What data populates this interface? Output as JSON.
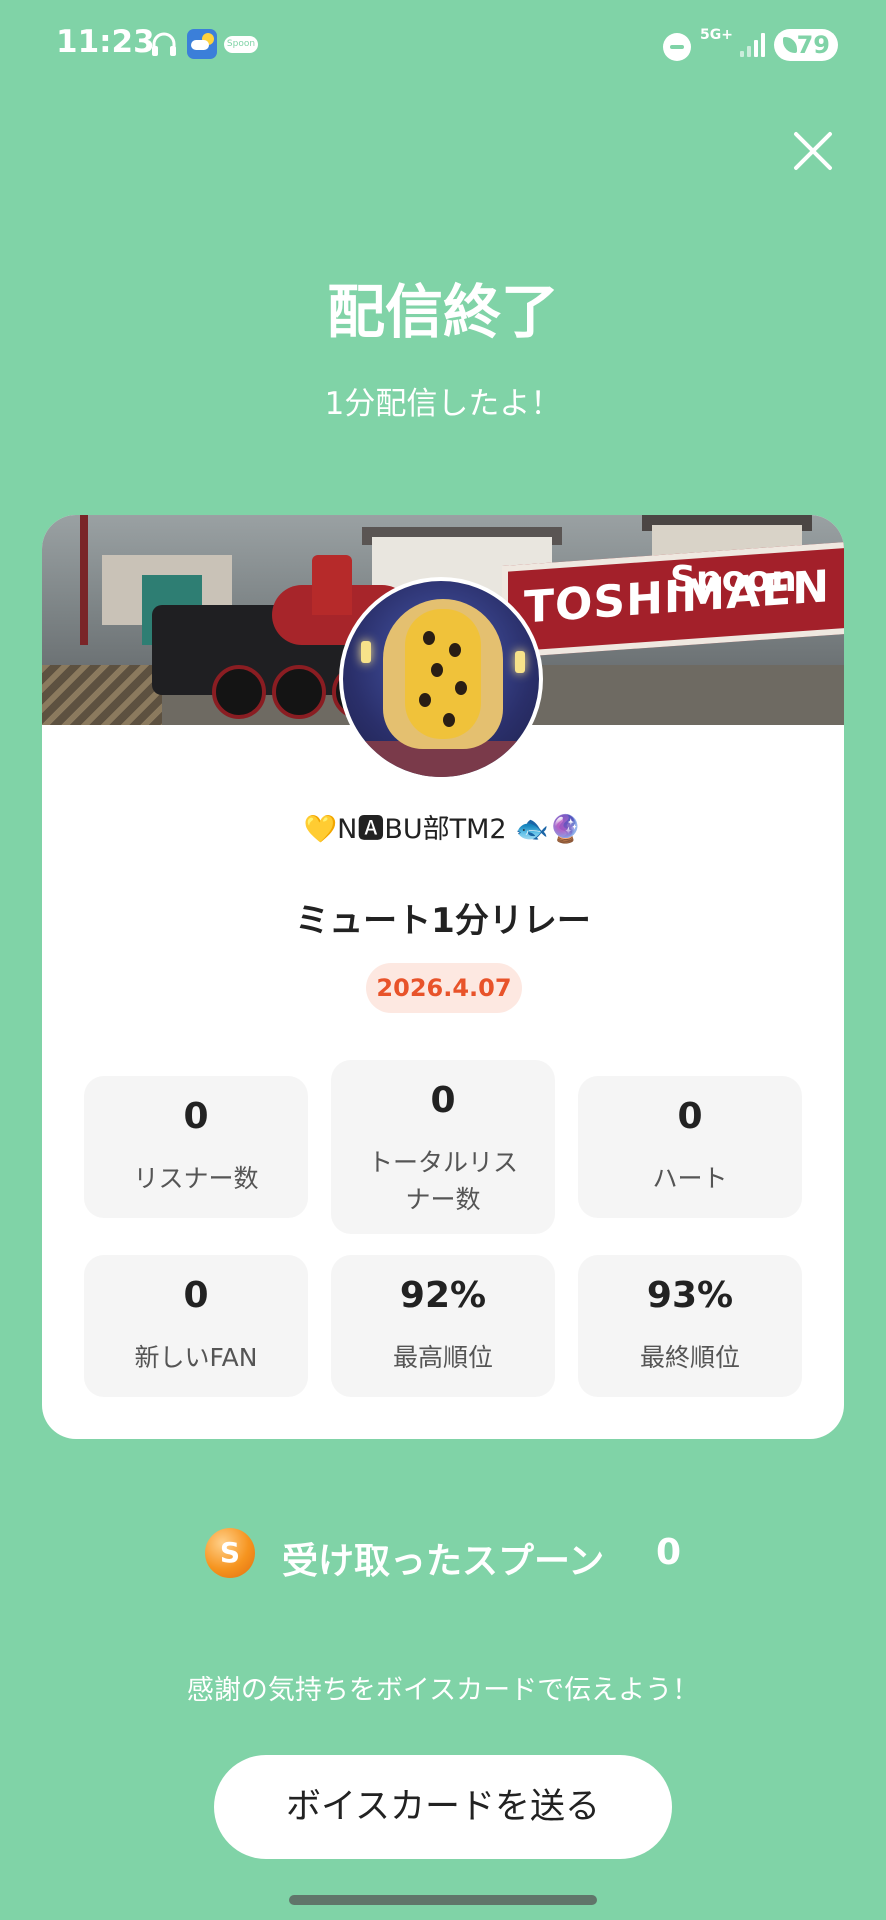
{
  "status_bar": {
    "time": "11:23",
    "network": "5G+",
    "battery": "79",
    "spoon_mini_label": "Spoon",
    "icons": [
      "headphone-icon",
      "weather-icon",
      "spoon-app-icon",
      "do-not-disturb-icon",
      "signal-icon",
      "battery-icon"
    ]
  },
  "header": {
    "title": "配信終了",
    "subtitle": "1分配信したよ！",
    "close_icon": "close-icon"
  },
  "card": {
    "brand": "Spoon",
    "banner_sign": "TOSHIMAEN",
    "username": "💛N🅰BU部TM2 🐟🔮",
    "room_title": "ミュート1分リレー",
    "date": "2026.4.07",
    "stats": [
      {
        "value": "0",
        "label": "リスナー数"
      },
      {
        "value": "0",
        "label": "トータルリスナー数"
      },
      {
        "value": "0",
        "label": "ハート"
      },
      {
        "value": "0",
        "label": "新しいFAN"
      },
      {
        "value": "92%",
        "label": "最高順位"
      },
      {
        "value": "93%",
        "label": "最終順位"
      }
    ]
  },
  "spoons": {
    "coin_letter": "S",
    "label": "受け取ったスプーン",
    "count": "0"
  },
  "footer": {
    "message": "感謝の気持ちをボイスカードで伝えよう！",
    "button_label": "ボイスカードを送る"
  },
  "colors": {
    "background": "#80d3a7",
    "date_badge_text": "#e8532a",
    "date_badge_bg": "#fde8e1",
    "coin": "#f6941f"
  }
}
